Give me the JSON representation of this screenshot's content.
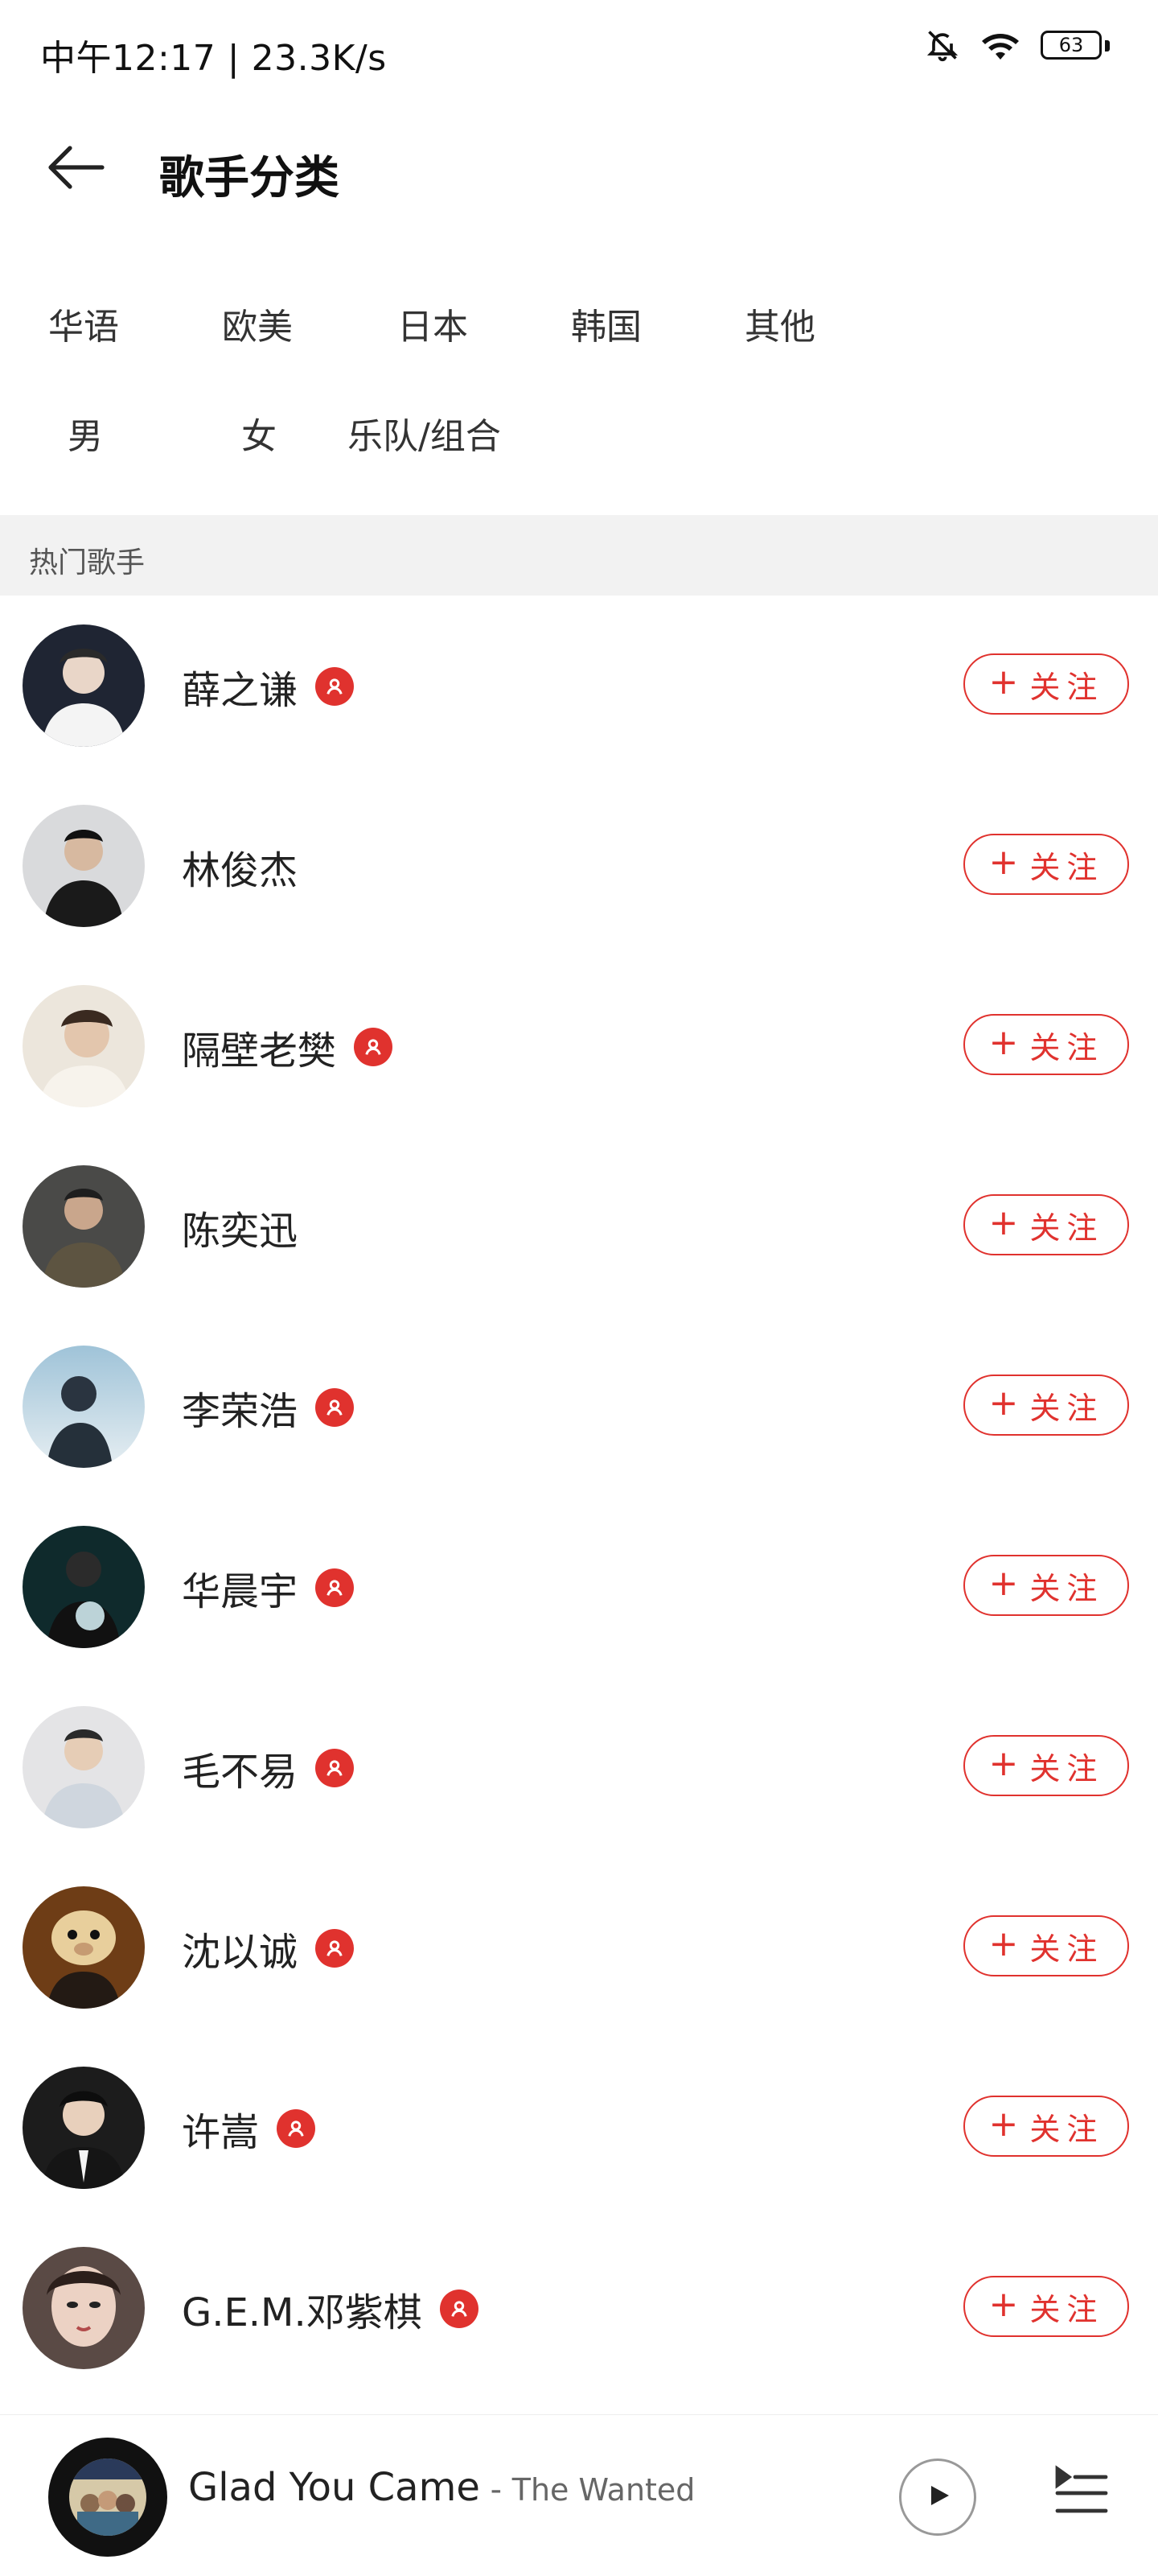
{
  "status_bar": {
    "time_text": "中午12:17 | 23.3K/s",
    "battery": "63",
    "icons": [
      "bell-mute-icon",
      "wifi-icon",
      "battery-icon"
    ]
  },
  "header": {
    "title": "歌手分类",
    "back_icon": "arrow-left-icon"
  },
  "filters": {
    "regions": [
      "华语",
      "欧美",
      "日本",
      "韩国",
      "其他"
    ],
    "types": [
      "男",
      "女",
      "乐队/组合"
    ]
  },
  "section": {
    "title": "热门歌手"
  },
  "artists": [
    {
      "name": "薛之谦",
      "verified": true,
      "follow_label": "关注"
    },
    {
      "name": "林俊杰",
      "verified": false,
      "follow_label": "关注"
    },
    {
      "name": "隔壁老樊",
      "verified": true,
      "follow_label": "关注"
    },
    {
      "name": "陈奕迅",
      "verified": false,
      "follow_label": "关注"
    },
    {
      "name": "李荣浩",
      "verified": true,
      "follow_label": "关注"
    },
    {
      "name": "华晨宇",
      "verified": true,
      "follow_label": "关注"
    },
    {
      "name": "毛不易",
      "verified": true,
      "follow_label": "关注"
    },
    {
      "name": "沈以诚",
      "verified": true,
      "follow_label": "关注"
    },
    {
      "name": "许嵩",
      "verified": true,
      "follow_label": "关注"
    },
    {
      "name": "G.E.M.邓紫棋",
      "verified": true,
      "follow_label": "关注"
    }
  ],
  "player": {
    "song_title": "Glad You Came",
    "separator": " - ",
    "artist": "The Wanted"
  },
  "colors": {
    "accent": "#e0322e",
    "section_bg": "#f2f2f2"
  }
}
